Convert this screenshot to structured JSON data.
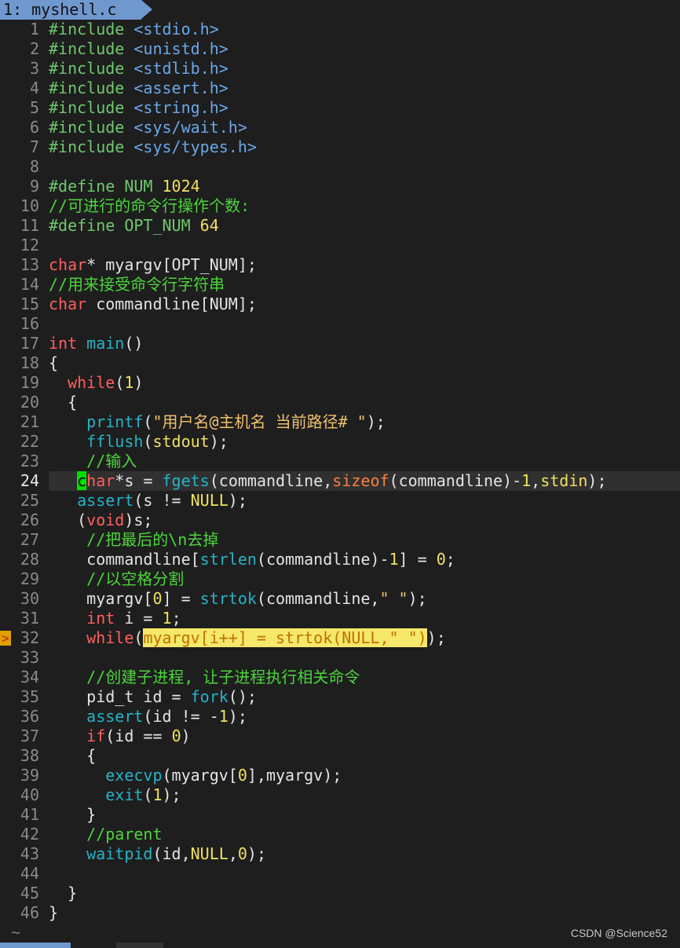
{
  "tab": {
    "label": "1: myshell.c"
  },
  "watermark": "CSDN @Science52",
  "tilde": "~",
  "current_line": 24,
  "lines": [
    {
      "n": "1",
      "segs": [
        [
          "pp",
          "#include "
        ],
        [
          "inc",
          "<stdio.h>"
        ]
      ]
    },
    {
      "n": "2",
      "segs": [
        [
          "pp",
          "#include "
        ],
        [
          "inc",
          "<unistd.h>"
        ]
      ]
    },
    {
      "n": "3",
      "segs": [
        [
          "pp",
          "#include "
        ],
        [
          "inc",
          "<stdlib.h>"
        ]
      ]
    },
    {
      "n": "4",
      "segs": [
        [
          "pp",
          "#include "
        ],
        [
          "inc",
          "<assert.h>"
        ]
      ]
    },
    {
      "n": "5",
      "segs": [
        [
          "pp",
          "#include "
        ],
        [
          "inc",
          "<string.h>"
        ]
      ]
    },
    {
      "n": "6",
      "segs": [
        [
          "pp",
          "#include "
        ],
        [
          "inc",
          "<sys/wait.h>"
        ]
      ]
    },
    {
      "n": "7",
      "segs": [
        [
          "pp",
          "#include "
        ],
        [
          "inc",
          "<sys/types.h>"
        ]
      ]
    },
    {
      "n": "8",
      "segs": []
    },
    {
      "n": "9",
      "segs": [
        [
          "pp",
          "#define NUM "
        ],
        [
          "num",
          "1024"
        ]
      ]
    },
    {
      "n": "10",
      "segs": [
        [
          "cm",
          "//可进行的命令行操作个数:"
        ]
      ]
    },
    {
      "n": "11",
      "segs": [
        [
          "pp",
          "#define OPT_NUM "
        ],
        [
          "num",
          "64"
        ]
      ]
    },
    {
      "n": "12",
      "segs": []
    },
    {
      "n": "13",
      "segs": [
        [
          "kw",
          "char"
        ],
        [
          "",
          "* myargv[OPT_NUM];"
        ]
      ]
    },
    {
      "n": "14",
      "segs": [
        [
          "cm",
          "//用来接受命令行字符串"
        ]
      ]
    },
    {
      "n": "15",
      "segs": [
        [
          "kw",
          "char"
        ],
        [
          "",
          " commandline[NUM];"
        ]
      ]
    },
    {
      "n": "16",
      "segs": []
    },
    {
      "n": "17",
      "segs": [
        [
          "kw",
          "int"
        ],
        [
          "",
          " "
        ],
        [
          "fn",
          "main"
        ],
        [
          "",
          "()"
        ]
      ]
    },
    {
      "n": "18",
      "segs": [
        [
          "",
          "{"
        ]
      ]
    },
    {
      "n": "19",
      "segs": [
        [
          "",
          "  "
        ],
        [
          "kw",
          "while"
        ],
        [
          "",
          "("
        ],
        [
          "num",
          "1"
        ],
        [
          "",
          ")"
        ]
      ]
    },
    {
      "n": "20",
      "segs": [
        [
          "",
          "  {"
        ]
      ]
    },
    {
      "n": "21",
      "segs": [
        [
          "",
          "    "
        ],
        [
          "fn",
          "printf"
        ],
        [
          "",
          "("
        ],
        [
          "str",
          "\"用户名@主机名 当前路径# \""
        ],
        [
          "",
          ");"
        ]
      ]
    },
    {
      "n": "22",
      "segs": [
        [
          "",
          "    "
        ],
        [
          "fn",
          "fflush"
        ],
        [
          "",
          "("
        ],
        [
          "num",
          "stdout"
        ],
        [
          "",
          ");"
        ]
      ]
    },
    {
      "n": "23",
      "segs": [
        [
          "",
          "    "
        ],
        [
          "cm",
          "//输入"
        ]
      ]
    },
    {
      "n": "24",
      "segs": [
        [
          "",
          "   "
        ],
        [
          "cursor",
          "c"
        ],
        [
          "kw",
          "har"
        ],
        [
          "",
          "*s = "
        ],
        [
          "fn",
          "fgets"
        ],
        [
          "",
          "(commandline,"
        ],
        [
          "sf",
          "sizeof"
        ],
        [
          "",
          "(commandline)-"
        ],
        [
          "num",
          "1"
        ],
        [
          "",
          ","
        ],
        [
          "num",
          "stdin"
        ],
        [
          "",
          ");"
        ]
      ]
    },
    {
      "n": "25",
      "segs": [
        [
          "",
          "   "
        ],
        [
          "fn",
          "assert"
        ],
        [
          "",
          "(s != "
        ],
        [
          "num",
          "NULL"
        ],
        [
          "",
          ");"
        ]
      ]
    },
    {
      "n": "26",
      "segs": [
        [
          "",
          "   ("
        ],
        [
          "kw",
          "void"
        ],
        [
          "",
          ")s;"
        ]
      ]
    },
    {
      "n": "27",
      "segs": [
        [
          "",
          "    "
        ],
        [
          "cm",
          "//把最后的\\n去掉"
        ]
      ]
    },
    {
      "n": "28",
      "segs": [
        [
          "",
          "    commandline["
        ],
        [
          "fn",
          "strlen"
        ],
        [
          "",
          "(commandline)-"
        ],
        [
          "num",
          "1"
        ],
        [
          "",
          "] = "
        ],
        [
          "num",
          "0"
        ],
        [
          "",
          ";"
        ]
      ]
    },
    {
      "n": "29",
      "segs": [
        [
          "",
          "    "
        ],
        [
          "cm",
          "//以空格分割"
        ]
      ]
    },
    {
      "n": "30",
      "segs": [
        [
          "",
          "    myargv["
        ],
        [
          "num",
          "0"
        ],
        [
          "",
          "] = "
        ],
        [
          "fn",
          "strtok"
        ],
        [
          "",
          "(commandline,"
        ],
        [
          "str",
          "\" \""
        ],
        [
          "",
          ");"
        ]
      ]
    },
    {
      "n": "31",
      "segs": [
        [
          "",
          "    "
        ],
        [
          "kw",
          "int"
        ],
        [
          "",
          " i = "
        ],
        [
          "num",
          "1"
        ],
        [
          "",
          ";"
        ]
      ]
    },
    {
      "n": "32",
      "sign": ">",
      "segs": [
        [
          "",
          "    "
        ],
        [
          "kw",
          "while"
        ],
        [
          "",
          "("
        ],
        [
          "hl",
          "myargv[i++] = strtok(NULL,\" \")"
        ],
        [
          "",
          ");"
        ]
      ]
    },
    {
      "n": "33",
      "segs": []
    },
    {
      "n": "34",
      "segs": [
        [
          "",
          "    "
        ],
        [
          "cm",
          "//创建子进程, 让子进程执行相关命令"
        ]
      ]
    },
    {
      "n": "35",
      "segs": [
        [
          "",
          "    pid_t id = "
        ],
        [
          "fn",
          "fork"
        ],
        [
          "",
          "();"
        ]
      ]
    },
    {
      "n": "36",
      "segs": [
        [
          "",
          "    "
        ],
        [
          "fn",
          "assert"
        ],
        [
          "",
          "(id != -"
        ],
        [
          "num",
          "1"
        ],
        [
          "",
          ");"
        ]
      ]
    },
    {
      "n": "37",
      "segs": [
        [
          "",
          "    "
        ],
        [
          "kw",
          "if"
        ],
        [
          "",
          "(id == "
        ],
        [
          "num",
          "0"
        ],
        [
          "",
          ")"
        ]
      ]
    },
    {
      "n": "38",
      "segs": [
        [
          "",
          "    {"
        ]
      ]
    },
    {
      "n": "39",
      "segs": [
        [
          "",
          "      "
        ],
        [
          "fn",
          "execvp"
        ],
        [
          "",
          "(myargv["
        ],
        [
          "num",
          "0"
        ],
        [
          "",
          "],myargv);"
        ]
      ]
    },
    {
      "n": "40",
      "segs": [
        [
          "",
          "      "
        ],
        [
          "fn",
          "exit"
        ],
        [
          "",
          "("
        ],
        [
          "num",
          "1"
        ],
        [
          "",
          ");"
        ]
      ]
    },
    {
      "n": "41",
      "segs": [
        [
          "",
          "    }"
        ]
      ]
    },
    {
      "n": "42",
      "segs": [
        [
          "",
          "    "
        ],
        [
          "cm",
          "//parent"
        ]
      ]
    },
    {
      "n": "43",
      "segs": [
        [
          "",
          "    "
        ],
        [
          "fn",
          "waitpid"
        ],
        [
          "",
          "(id,"
        ],
        [
          "num",
          "NULL"
        ],
        [
          "",
          ","
        ],
        [
          "num",
          "0"
        ],
        [
          "",
          ");"
        ]
      ]
    },
    {
      "n": "44",
      "segs": []
    },
    {
      "n": "45",
      "segs": [
        [
          "",
          "  }"
        ]
      ]
    },
    {
      "n": "46",
      "segs": [
        [
          "",
          "}"
        ]
      ]
    }
  ]
}
